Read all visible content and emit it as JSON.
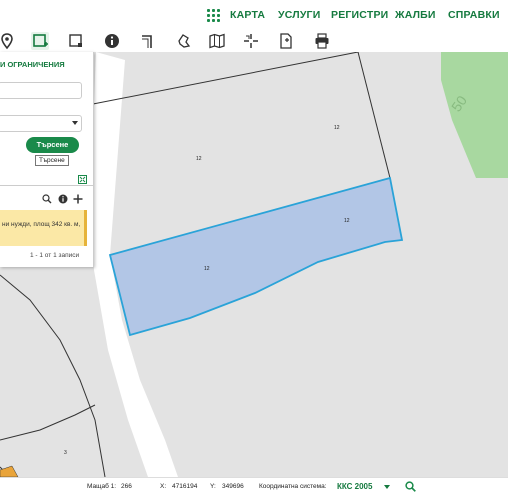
{
  "nav": {
    "menu_icon": "apps-grid-icon",
    "items": [
      "КАРТА",
      "УСЛУГИ",
      "РЕГИСТРИ",
      "ЖАЛБИ",
      "СПРАВКИ"
    ]
  },
  "toolbar": {
    "tools": [
      "location-pin-icon",
      "select-rectangle-icon",
      "select-area-icon",
      "info-icon",
      "measure-angle-icon",
      "pan-hand-icon",
      "map-layers-icon",
      "crosshair-icon",
      "document-icon",
      "print-icon"
    ],
    "active_tool": "select-rectangle-icon"
  },
  "panel": {
    "title": "И ОГРАНИЧЕНИЯ",
    "input_value": "",
    "select_value": "",
    "search_button": "Търсене",
    "tooltip": "Търсене",
    "result_text": "ни нужди, площ 342 кв. м,",
    "pager": "1 - 1 от 1 записи"
  },
  "map": {
    "labels": [
      "12",
      "12",
      "12",
      "12",
      "3",
      "50"
    ],
    "colors": {
      "background": "#e3e3e3",
      "green_area": "#a8d8a0",
      "selection_fill": "#a9c1e6",
      "selection_stroke": "#2aa3d8",
      "road": "#ffffff"
    }
  },
  "status": {
    "scale_label": "Мащаб 1:",
    "scale_value": "266",
    "x_label": "X:",
    "x_value": "4716194",
    "y_label": "Y:",
    "y_value": "349696",
    "coord_system_label": "Координатна система:",
    "coord_system_value": "ККС 2005"
  },
  "colors": {
    "brand": "#157a3f",
    "accent": "#1a8a4a"
  }
}
